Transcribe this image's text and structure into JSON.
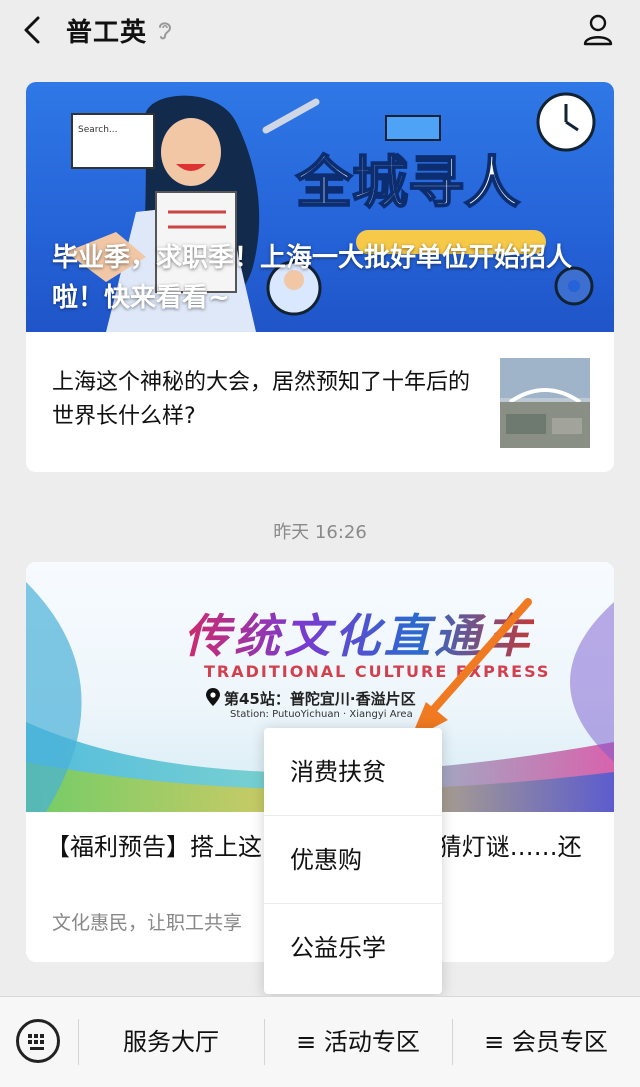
{
  "header": {
    "title": "普工英"
  },
  "feed": {
    "article1": {
      "banner_caption": "毕业季，求职季！上海一大批好单位开始招人啦！快来看看~",
      "banner_headline": "全城寻人",
      "search_placeholder": "Search...",
      "sub_title": "上海这个神秘的大会，居然预知了十年后的世界长什么样?"
    },
    "timestamp": "昨天 16:26",
    "article2": {
      "banner_title": "传统文化直通车",
      "banner_title_en": "TRADITIONAL CULTURE EXPRESS",
      "station": "第45站：普陀宜川·香溢片区",
      "station_en": "Station: PutuoYichuan · Xiangyi Area",
      "title": "【福利预告】搭上这                   通车，写书法、猜灯谜……还",
      "summary": "文化惠民，让职工共享"
    }
  },
  "popup_menu": {
    "items": [
      {
        "label": "消费扶贫"
      },
      {
        "label": "优惠购"
      },
      {
        "label": "公益乐学"
      }
    ]
  },
  "bottom_menu": {
    "items": [
      {
        "label": "服务大厅"
      },
      {
        "label": "≡ 活动专区"
      },
      {
        "label": "≡ 会员专区"
      }
    ]
  },
  "colors": {
    "accent_arrow": "#f07a22",
    "banner_blue": "#2563d8"
  }
}
